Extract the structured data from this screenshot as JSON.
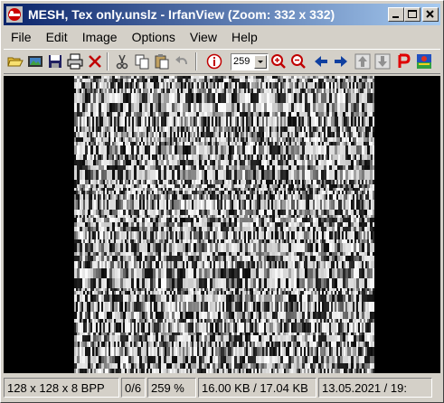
{
  "window": {
    "title": "MESH, Tex only.unslz - IrfanView (Zoom: 332 x 332)"
  },
  "menu": {
    "items": [
      "File",
      "Edit",
      "Image",
      "Options",
      "View",
      "Help"
    ]
  },
  "toolbar": {
    "tools": [
      {
        "name": "open-folder-icon"
      },
      {
        "name": "slideshow-icon"
      },
      {
        "name": "save-icon"
      },
      {
        "name": "print-icon"
      },
      {
        "name": "delete-icon"
      },
      {
        "name": "cut-icon"
      },
      {
        "name": "copy-icon"
      },
      {
        "name": "paste-icon"
      },
      {
        "name": "undo-icon"
      },
      {
        "name": "info-icon"
      },
      {
        "name": "zoom-in-icon"
      },
      {
        "name": "zoom-out-icon"
      },
      {
        "name": "previous-arrow-icon"
      },
      {
        "name": "next-arrow-icon"
      },
      {
        "name": "first-file-icon"
      },
      {
        "name": "last-file-icon"
      },
      {
        "name": "paint-icon"
      },
      {
        "name": "irfanview-logo-icon"
      }
    ],
    "zoom_value": "259"
  },
  "status": {
    "dimensions": "128 x 128 x 8 BPP",
    "file_index": "0/6",
    "zoom": "259 %",
    "size": "16.00 KB / 17.04 KB",
    "date": "13.05.2021 / 19:"
  },
  "colors": {
    "titlebar_start": "#0a246a",
    "titlebar_end": "#a6caf0",
    "face": "#d4d0c8",
    "viewport_bg": "#000000"
  }
}
